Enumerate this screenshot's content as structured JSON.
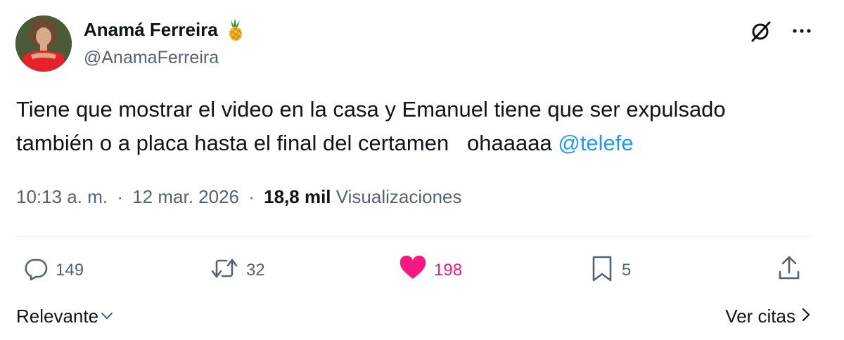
{
  "author": {
    "display_name": "Anamá Ferreira",
    "handle": "@AnamaFerreira",
    "name_emoji_icon": "pineapple-icon"
  },
  "tweet": {
    "line1": "Tiene que mostrar el video en la casa y Emanuel tiene que ser expulsado",
    "line2": "también o a placa hasta el final del certamen   ohaaaaa ",
    "mention": "@telefe"
  },
  "meta": {
    "time": "10:13 a. m.",
    "separator": "·",
    "date": "12 mar. 2026",
    "views_count": "18,8 mil",
    "views_label": "Visualizaciones"
  },
  "actions": {
    "replies": "149",
    "reposts": "32",
    "likes": "198",
    "bookmarks": "5"
  },
  "footer": {
    "sort_label": "Relevante",
    "quotes_label": "Ver citas"
  },
  "colors": {
    "link": "#1d9bf0",
    "like": "#f91880",
    "muted": "#536471",
    "text": "#0f1419"
  }
}
